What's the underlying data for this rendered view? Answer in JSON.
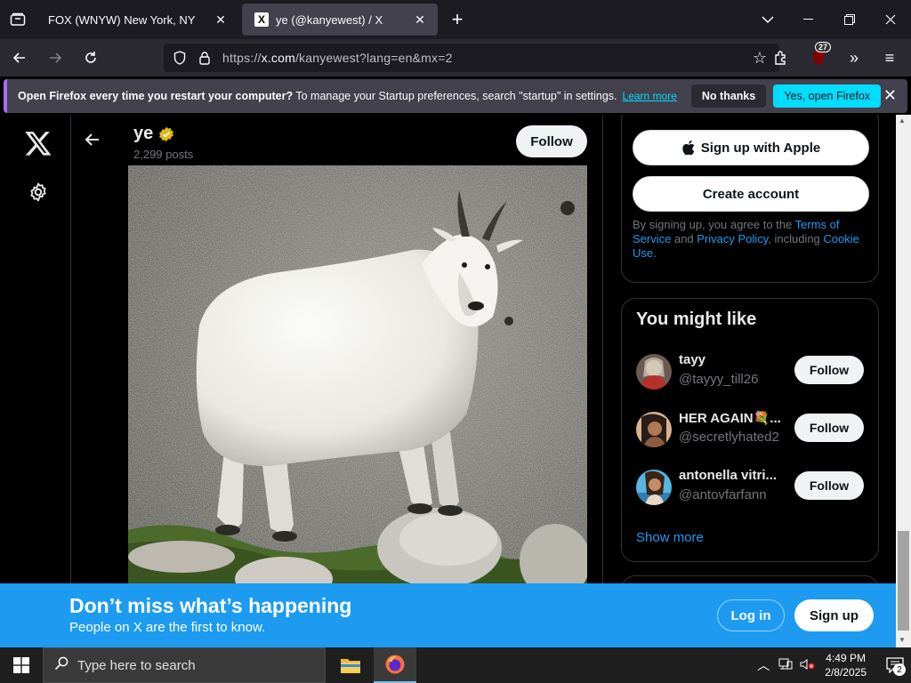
{
  "browser": {
    "tabs": [
      {
        "title": "FOX (WNYW) New York, NY",
        "active": false
      },
      {
        "title": "ye (@kanyewest) / X",
        "active": true,
        "favicon": "X"
      }
    ],
    "url": {
      "prefix": "https://",
      "domain": "x.com",
      "rest": "/kanyewest?lang=en&mx=2"
    },
    "extension_badge": "27",
    "notification": {
      "bold": "Open Firefox every time you restart your computer?",
      "text": " To manage your Startup preferences, search \"startup\" in settings.",
      "learn_more": "Learn more",
      "no_thanks": "No thanks",
      "yes": "Yes, open Firefox"
    }
  },
  "profile": {
    "name": "ye",
    "post_count": "2,299 posts",
    "follow_label": "Follow"
  },
  "signup": {
    "apple_label": "Sign up with Apple",
    "create_label": "Create account",
    "terms_prefix": "By signing up, you agree to the ",
    "terms_link": "Terms of Service",
    "and": " and ",
    "privacy_link": "Privacy Policy",
    "including": ", including ",
    "cookie_link": "Cookie Use",
    "end": "."
  },
  "might_like": {
    "title": "You might like",
    "items": [
      {
        "name": "tayy",
        "handle": "@tayyy_till26",
        "follow": "Follow"
      },
      {
        "name": "HER AGAIN💐...",
        "handle": "@secretlyhated2",
        "follow": "Follow"
      },
      {
        "name": "antonella vitri...",
        "handle": "@antovfarfann",
        "follow": "Follow"
      }
    ],
    "show_more": "Show more"
  },
  "banner": {
    "headline": "Don’t miss what’s happening",
    "sub": "People on X are the first to know.",
    "login": "Log in",
    "signup": "Sign up"
  },
  "taskbar": {
    "search_placeholder": "Type here to search",
    "time": "4:49 PM",
    "date": "2/8/2025",
    "notification_count": "2"
  }
}
